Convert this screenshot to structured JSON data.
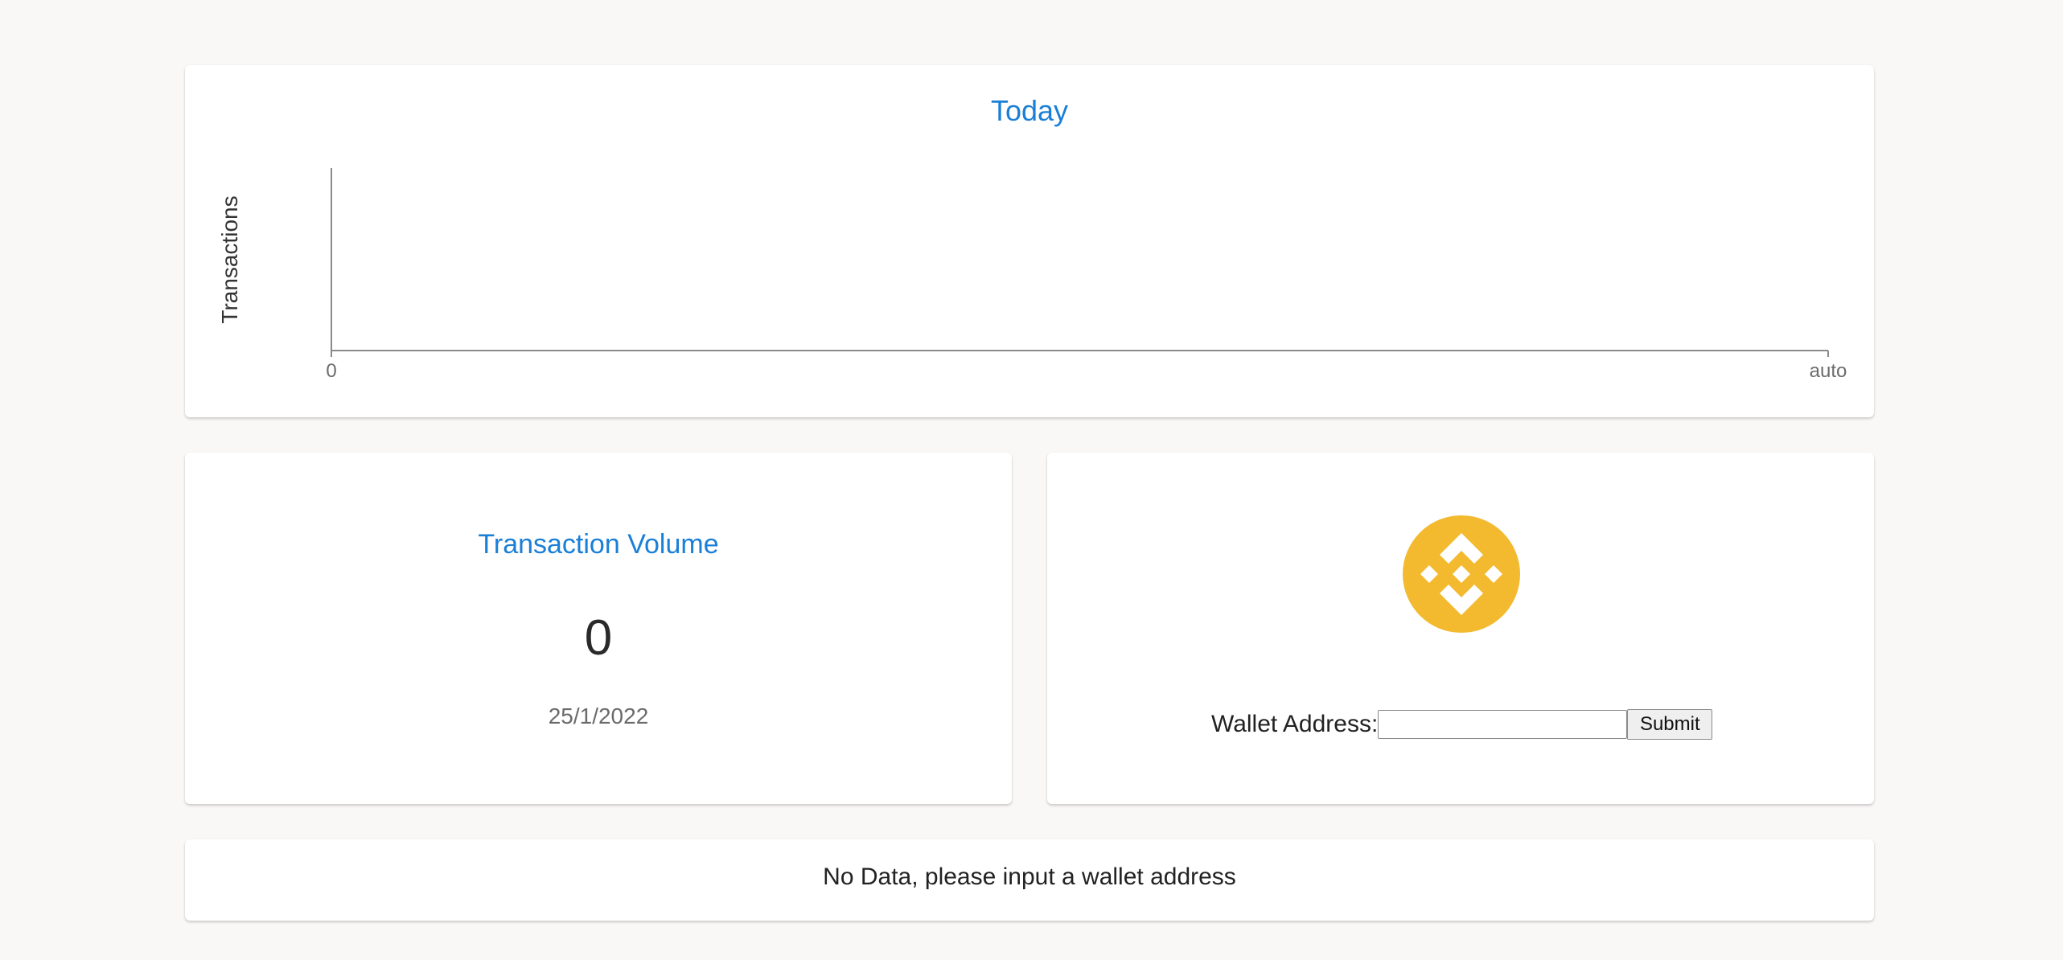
{
  "chart": {
    "title": "Today",
    "ylabel": "Transactions"
  },
  "chart_data": {
    "type": "line",
    "title": "Today",
    "xlabel": "",
    "ylabel": "Transactions",
    "x_ticks": [
      "0",
      "auto"
    ],
    "series": [],
    "grid": false
  },
  "volume": {
    "title": "Transaction Volume",
    "value": "0",
    "date": "25/1/2022"
  },
  "wallet": {
    "logo_icon": "binance-icon",
    "logo_color": "#F3BA2F",
    "label": "Wallet Address:",
    "input_value": "",
    "submit_label": "Submit"
  },
  "status": {
    "message": "No Data, please input a wallet address"
  },
  "colors": {
    "accent": "#1A7FD6",
    "background": "#F9F8F7"
  }
}
